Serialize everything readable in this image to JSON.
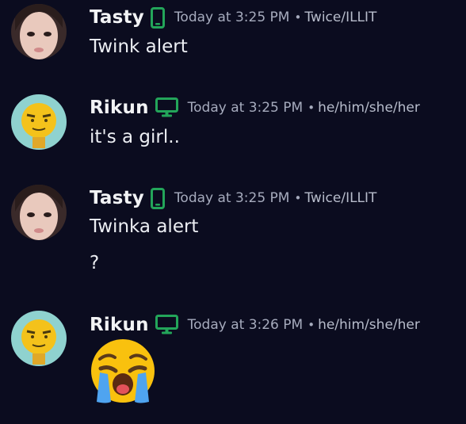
{
  "colors": {
    "background": "#0b0c1f",
    "device_icon": "#23a55a",
    "timestamp": "#a6abbd",
    "username": "#f2f3f5"
  },
  "messages": [
    {
      "username": "Tasty",
      "device_icon": "mobile-phone-icon",
      "timestamp": "Today at 3:25 PM",
      "separator": "•",
      "pronouns": "Twice/ILLIT",
      "lines": [
        "Twink alert"
      ]
    },
    {
      "username": "Rikun",
      "device_icon": "desktop-monitor-icon",
      "timestamp": "Today at 3:25 PM",
      "separator": "•",
      "pronouns": "he/him/she/her",
      "lines": [
        "it's a girl.."
      ]
    },
    {
      "username": "Tasty",
      "device_icon": "mobile-phone-icon",
      "timestamp": "Today at 3:25 PM",
      "separator": "•",
      "pronouns": "Twice/ILLIT",
      "lines": [
        "Twinka alert",
        "?"
      ]
    },
    {
      "username": "Rikun",
      "device_icon": "desktop-monitor-icon",
      "timestamp": "Today at 3:26 PM",
      "separator": "•",
      "pronouns": "he/him/she/her",
      "emoji": "loudly-crying-face-icon"
    }
  ]
}
